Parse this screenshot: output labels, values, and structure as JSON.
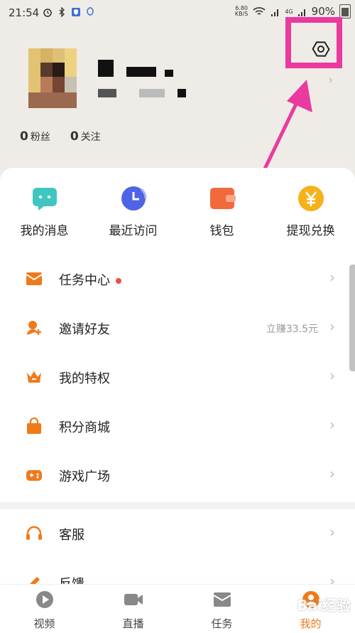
{
  "status_bar": {
    "time": "21:54",
    "net_speed": "6.80",
    "net_unit": "KB/S",
    "battery": "90%",
    "signal_label": "4G"
  },
  "profile": {
    "followers_count": "0",
    "followers_label": "粉丝",
    "following_count": "0",
    "following_label": "关注"
  },
  "quick_actions": [
    {
      "label": "我的消息",
      "icon": "message-icon",
      "color": "#3fc6c0"
    },
    {
      "label": "最近访问",
      "icon": "clock-icon",
      "color": "#4f63e6"
    },
    {
      "label": "钱包",
      "icon": "wallet-icon",
      "color": "#f26a3b"
    },
    {
      "label": "提现兑换",
      "icon": "yuan-coin-icon",
      "color": "#f6b21a"
    }
  ],
  "menu": [
    {
      "label": "任务中心",
      "icon": "task-envelope-icon",
      "dot": true,
      "extra": ""
    },
    {
      "label": "邀请好友",
      "icon": "invite-friend-icon",
      "dot": false,
      "extra": "立赚33.5元"
    },
    {
      "label": "我的特权",
      "icon": "crown-icon",
      "dot": false,
      "extra": ""
    },
    {
      "label": "积分商城",
      "icon": "shopping-bag-icon",
      "dot": false,
      "extra": ""
    },
    {
      "label": "游戏广场",
      "icon": "gamepad-icon",
      "dot": false,
      "extra": ""
    }
  ],
  "menu2": [
    {
      "label": "客服",
      "icon": "headset-icon"
    },
    {
      "label": "反馈",
      "icon": "pencil-icon"
    }
  ],
  "bottom_nav": [
    {
      "label": "视频",
      "icon": "play-icon",
      "active": false
    },
    {
      "label": "直播",
      "icon": "video-camera-icon",
      "active": false
    },
    {
      "label": "任务",
      "icon": "envelope-icon",
      "active": false
    },
    {
      "label": "我的",
      "icon": "profile-icon",
      "active": true
    }
  ],
  "colors": {
    "accent": "#f07a1a",
    "highlight_box": "#ea3a9f"
  },
  "watermark": "Bai经验"
}
